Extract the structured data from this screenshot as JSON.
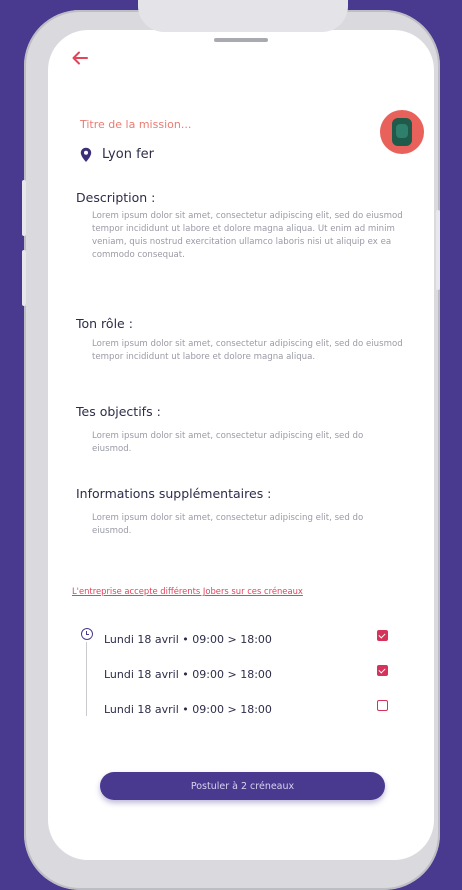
{
  "header": {
    "back_icon": "arrow-left-icon",
    "mission_title": "Titre de la mission...",
    "location": "Lyon fer",
    "location_icon": "map-pin-icon"
  },
  "sections": [
    {
      "title": "Description :",
      "body": "Lorem ipsum dolor sit amet, consectetur adipiscing elit, sed do eiusmod tempor incididunt ut labore et dolore magna aliqua. Ut enim ad minim veniam, quis nostrud exercitation ullamco laboris nisi ut aliquip ex ea commodo consequat."
    },
    {
      "title": "Ton rôle :",
      "body": "Lorem ipsum dolor sit amet, consectetur adipiscing elit, sed do eiusmod tempor incididunt ut labore et dolore magna aliqua."
    },
    {
      "title": "Tes objectifs :",
      "body": "Lorem ipsum dolor sit amet, consectetur adipiscing elit, sed do eiusmod."
    },
    {
      "title": "Informations supplémentaires :",
      "body": "Lorem ipsum dolor sit amet, consectetur adipiscing elit, sed do eiusmod."
    }
  ],
  "slots_notice": "L'entreprise accepte différents Jobers sur ces créneaux",
  "slots": [
    {
      "day": "Lundi 18 avril",
      "time": "09:00 > 18:00",
      "checked": true
    },
    {
      "day": "Lundi 18 avril",
      "time": "09:00 > 18:00",
      "checked": true
    },
    {
      "day": "Lundi 18 avril",
      "time": "09:00 > 18:00",
      "checked": false
    }
  ],
  "cta_label": "Postuler à 2 créneaux",
  "colors": {
    "background": "#4a3a8f",
    "accent": "#e0455a",
    "check": "#d6335a"
  }
}
